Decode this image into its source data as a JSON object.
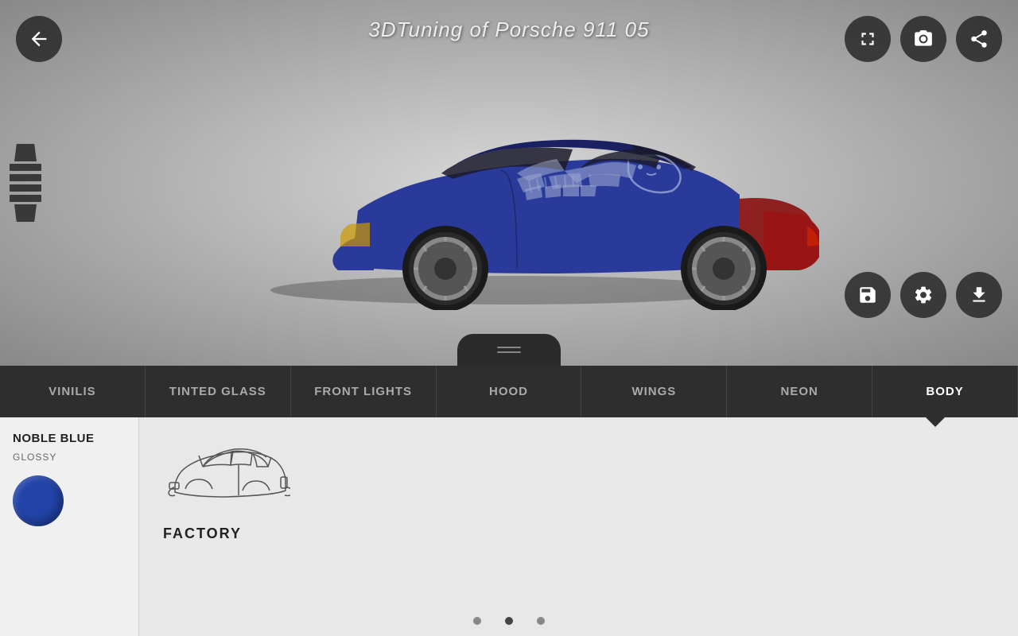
{
  "app": {
    "title": "3DTuning of Porsche 911 05"
  },
  "toolbar_top_right": {
    "fullscreen_label": "fullscreen",
    "camera_label": "camera",
    "export_label": "export"
  },
  "toolbar_bottom_right": {
    "save_label": "save",
    "settings_label": "settings",
    "download_label": "download"
  },
  "tabs": [
    {
      "id": "vinilis",
      "label": "VINILIS",
      "active": false
    },
    {
      "id": "tinted-glass",
      "label": "TINTED GLASS",
      "active": false
    },
    {
      "id": "front-lights",
      "label": "FRONT LIGHTS",
      "active": false
    },
    {
      "id": "hood",
      "label": "HOOD",
      "active": false
    },
    {
      "id": "wings",
      "label": "WINGS",
      "active": false
    },
    {
      "id": "neon",
      "label": "NEON",
      "active": false
    },
    {
      "id": "body",
      "label": "BODY",
      "active": true
    }
  ],
  "color_panel": {
    "color_name": "NOBLE BLUE",
    "finish": "GLOSSY",
    "swatch_color": "#2244aa"
  },
  "body_content": {
    "option_label": "FACTORY"
  },
  "pagination": {
    "dots": [
      {
        "active": false
      },
      {
        "active": true
      },
      {
        "active": false
      }
    ]
  }
}
